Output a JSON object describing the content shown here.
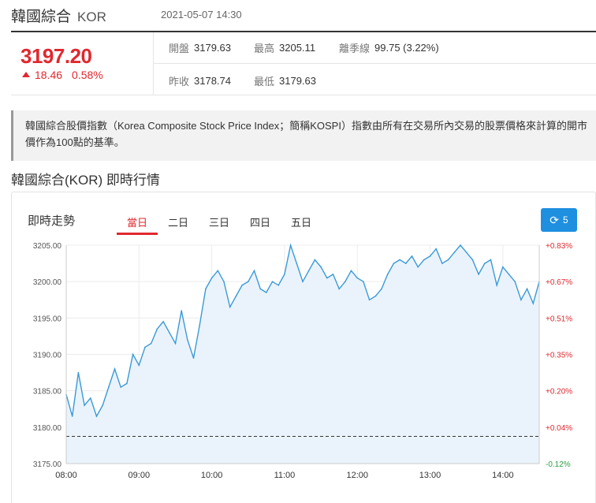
{
  "header": {
    "name": "韓國綜合",
    "code": "KOR",
    "datetime": "2021-05-07 14:30"
  },
  "quote": {
    "price": "3197.20",
    "change": "18.46",
    "change_pct": "0.58%",
    "open_label": "開盤",
    "open": "3179.63",
    "high_label": "最高",
    "high": "3205.11",
    "range_label": "離季線",
    "range": "99.75 (3.22%)",
    "prev_close_label": "昨收",
    "prev_close": "3178.74",
    "low_label": "最低",
    "low": "3179.63"
  },
  "description": "韓國綜合股價指數（Korea Composite Stock Price Index；簡稱KOSPI）指數由所有在交易所內交易的股票價格來計算的開市價作為100點的基準。",
  "section_title": "韓國綜合(KOR) 即時行情",
  "chart_panel": {
    "title": "即時走勢",
    "tabs": [
      "當日",
      "二日",
      "三日",
      "四日",
      "五日"
    ],
    "active_tab": 0,
    "refresh_label": "5"
  },
  "colors": {
    "up": "#e0282e",
    "down": "#2ea043",
    "line": "#3a9ad9",
    "fill": "#eaf3fb",
    "button": "#1f8fe0"
  },
  "chart_data": {
    "type": "area",
    "x": [
      "08:00",
      "08:05",
      "08:10",
      "08:15",
      "08:20",
      "08:25",
      "08:30",
      "08:35",
      "08:40",
      "08:45",
      "08:50",
      "08:55",
      "09:00",
      "09:05",
      "09:10",
      "09:15",
      "09:20",
      "09:25",
      "09:30",
      "09:35",
      "09:40",
      "09:45",
      "09:50",
      "09:55",
      "10:00",
      "10:05",
      "10:10",
      "10:15",
      "10:20",
      "10:25",
      "10:30",
      "10:35",
      "10:40",
      "10:45",
      "10:50",
      "10:55",
      "11:00",
      "11:05",
      "11:10",
      "11:15",
      "11:20",
      "11:25",
      "11:30",
      "11:35",
      "11:40",
      "11:45",
      "11:50",
      "11:55",
      "12:00",
      "12:05",
      "12:10",
      "12:15",
      "12:20",
      "12:25",
      "12:30",
      "12:35",
      "12:40",
      "12:45",
      "12:50",
      "12:55",
      "13:00",
      "13:05",
      "13:10",
      "13:15",
      "13:20",
      "13:25",
      "13:30",
      "13:35",
      "13:40",
      "13:45",
      "13:50",
      "13:55",
      "14:00",
      "14:05",
      "14:10",
      "14:15",
      "14:20",
      "14:25",
      "14:30"
    ],
    "values": [
      3184.5,
      3181.5,
      3187.5,
      3183.0,
      3184.0,
      3181.5,
      3183.0,
      3185.5,
      3188.0,
      3185.5,
      3186.0,
      3190.0,
      3188.5,
      3191.0,
      3191.5,
      3193.5,
      3194.5,
      3193.0,
      3191.5,
      3196.0,
      3192.0,
      3189.5,
      3194.0,
      3199.0,
      3200.5,
      3201.5,
      3200.0,
      3196.5,
      3198.0,
      3199.5,
      3200.0,
      3201.5,
      3199.0,
      3198.5,
      3200.0,
      3199.5,
      3201.0,
      3205.0,
      3202.5,
      3200.0,
      3201.5,
      3203.0,
      3202.0,
      3200.5,
      3201.0,
      3199.0,
      3200.0,
      3201.5,
      3200.5,
      3200.0,
      3197.5,
      3198.0,
      3199.0,
      3201.0,
      3202.5,
      3203.0,
      3202.5,
      3203.5,
      3202.0,
      3203.0,
      3203.5,
      3204.5,
      3202.5,
      3203.0,
      3204.0,
      3205.0,
      3204.0,
      3203.0,
      3201.0,
      3202.5,
      3203.0,
      3199.5,
      3202.0,
      3201.0,
      3200.0,
      3197.5,
      3199.0,
      3197.0,
      3200.0
    ],
    "prev_close": 3178.74,
    "ylim": [
      3175,
      3205
    ],
    "y_ticks": [
      "3175.00",
      "3180.00",
      "3185.00",
      "3190.00",
      "3195.00",
      "3200.00",
      "3205.00"
    ],
    "right_ticks": [
      "-0.12%",
      "+0.04%",
      "+0.20%",
      "+0.35%",
      "+0.51%",
      "+0.67%",
      "+0.83%"
    ],
    "x_ticks": [
      "08:00",
      "09:00",
      "10:00",
      "11:00",
      "12:00",
      "13:00",
      "14:00"
    ]
  }
}
